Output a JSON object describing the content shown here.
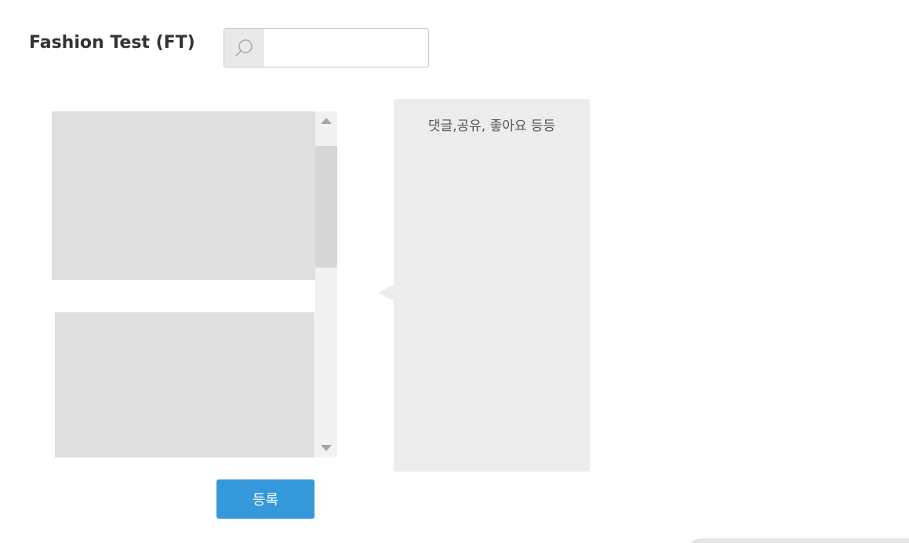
{
  "header": {
    "title": "Fashion Test (FT)"
  },
  "search": {
    "icon": "search-icon",
    "value": "",
    "placeholder": ""
  },
  "feed": {
    "scroll_up_icon": "triangle-up-icon",
    "scroll_down_icon": "triangle-down-icon",
    "scroll_position": 0.0
  },
  "actions": {
    "register_label": "등록"
  },
  "comment_panel": {
    "text": "댓글,공유, 좋아요 등등"
  },
  "colors": {
    "accent": "#3498db",
    "placeholder_gray": "#dfdfdf",
    "panel_gray": "#ececec"
  }
}
